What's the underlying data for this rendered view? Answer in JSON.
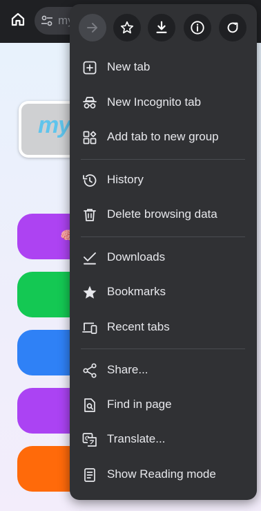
{
  "toolbar": {
    "url_text": "my"
  },
  "page": {
    "logo_text": "my",
    "pill_emoji": "🧠"
  },
  "menu": {
    "items": [
      {
        "label": "New tab",
        "icon": "new-tab-icon"
      },
      {
        "label": "New Incognito tab",
        "icon": "incognito-icon"
      },
      {
        "label": "Add tab to new group",
        "icon": "tab-group-icon"
      },
      {
        "label": "History",
        "icon": "history-icon"
      },
      {
        "label": "Delete browsing data",
        "icon": "trash-icon"
      },
      {
        "label": "Downloads",
        "icon": "downloads-check-icon"
      },
      {
        "label": "Bookmarks",
        "icon": "star-filled-icon"
      },
      {
        "label": "Recent tabs",
        "icon": "devices-icon"
      },
      {
        "label": "Share...",
        "icon": "share-icon"
      },
      {
        "label": "Find in page",
        "icon": "find-in-page-icon"
      },
      {
        "label": "Translate...",
        "icon": "translate-icon"
      },
      {
        "label": "Show Reading mode",
        "icon": "reading-mode-icon"
      }
    ]
  },
  "colors": {
    "menu_bg": "#303134",
    "text": "#e7e8ec",
    "topbar_bg": "#1f2023"
  }
}
